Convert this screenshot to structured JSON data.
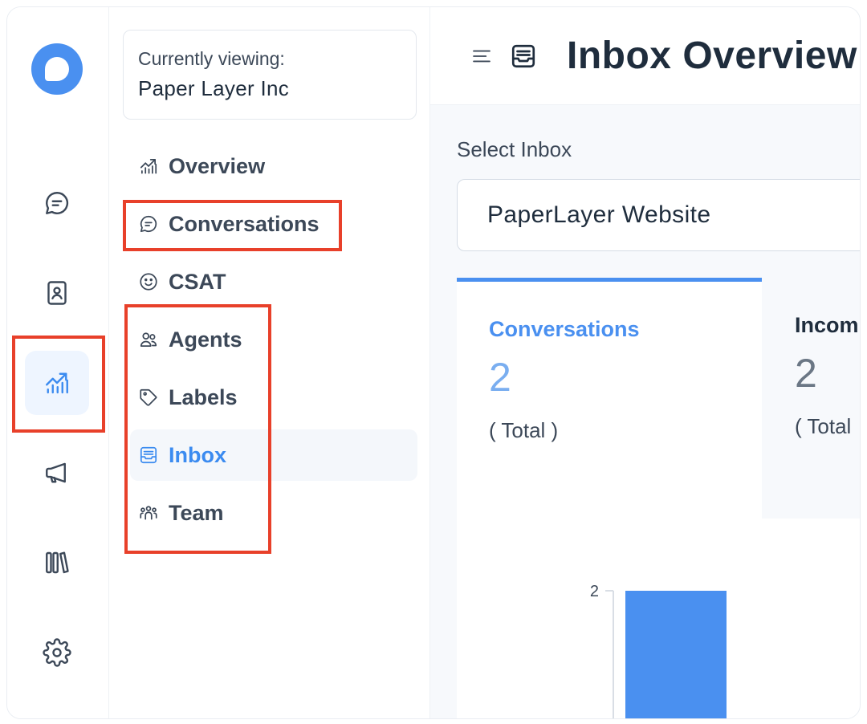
{
  "account": {
    "label": "Currently viewing:",
    "name": "Paper Layer Inc"
  },
  "rail": {
    "items": [
      {
        "icon": "chat-bubble-icon"
      },
      {
        "icon": "contacts-book-icon"
      },
      {
        "icon": "reports-chart-icon",
        "active": true
      },
      {
        "icon": "megaphone-icon"
      },
      {
        "icon": "library-icon"
      },
      {
        "icon": "gear-icon"
      }
    ]
  },
  "subnav": {
    "items": [
      {
        "label": "Overview",
        "icon": "trend-chart-icon"
      },
      {
        "label": "Conversations",
        "icon": "chat-bubble-icon"
      },
      {
        "label": "CSAT",
        "icon": "smiley-icon"
      },
      {
        "label": "Agents",
        "icon": "people-icon"
      },
      {
        "label": "Labels",
        "icon": "tag-icon"
      },
      {
        "label": "Inbox",
        "icon": "inbox-tray-icon",
        "active": true
      },
      {
        "label": "Team",
        "icon": "team-icon"
      }
    ]
  },
  "header": {
    "title": "Inbox Overview"
  },
  "inbox_select": {
    "label": "Select Inbox",
    "value": "PaperLayer Website"
  },
  "metrics": [
    {
      "title": "Conversations",
      "value": "2",
      "sub": "( Total )",
      "active": true
    },
    {
      "title": "Incom",
      "value": "2",
      "sub": "( Total",
      "active": false
    }
  ],
  "colors": {
    "accent": "#4a90f0",
    "highlight": "#e8402a"
  },
  "chart_data": {
    "type": "bar",
    "categories": [
      ""
    ],
    "values": [
      2
    ],
    "yticks": [
      "2"
    ],
    "title": "",
    "xlabel": "",
    "ylabel": ""
  }
}
